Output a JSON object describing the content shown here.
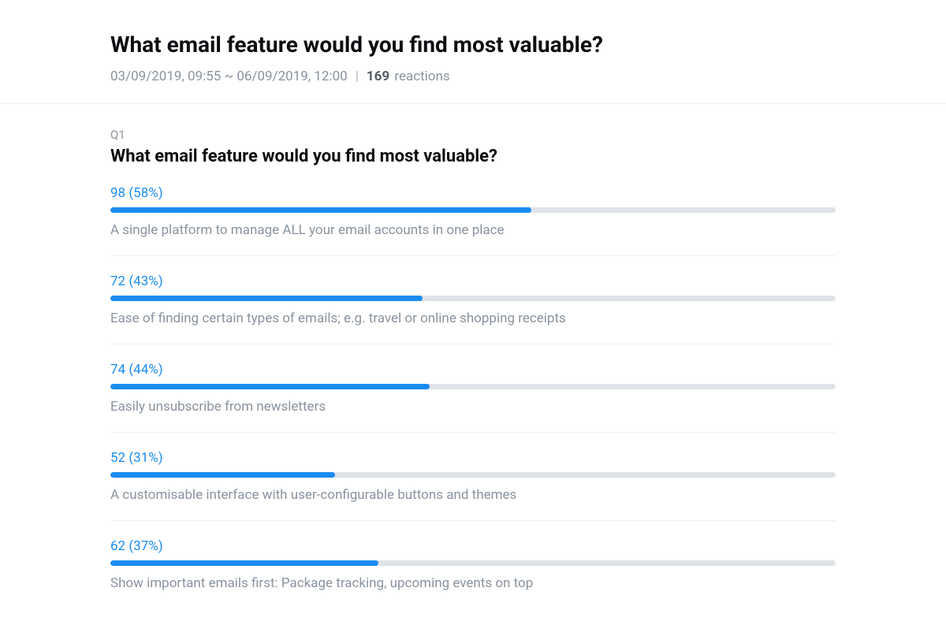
{
  "header": {
    "title": "What email feature would you find most valuable?",
    "date_range": "03/09/2019, 09:55 ~ 06/09/2019, 12:00",
    "reactions_count": "169",
    "reactions_label": "reactions"
  },
  "question": {
    "label": "Q1",
    "title": "What email feature would you find most valuable?"
  },
  "results": [
    {
      "count": 98,
      "percent": 58,
      "stat_text": "98 (58%)",
      "label": "A single platform to manage ALL your email accounts in one place"
    },
    {
      "count": 72,
      "percent": 43,
      "stat_text": "72 (43%)",
      "label": "Ease of finding certain types of emails; e.g. travel or online shopping receipts"
    },
    {
      "count": 74,
      "percent": 44,
      "stat_text": "74 (44%)",
      "label": "Easily unsubscribe from newsletters"
    },
    {
      "count": 52,
      "percent": 31,
      "stat_text": "52 (31%)",
      "label": "A customisable interface with user-configurable buttons and themes"
    },
    {
      "count": 62,
      "percent": 37,
      "stat_text": "62 (37%)",
      "label": "Show important emails first: Package tracking, upcoming events on top"
    }
  ],
  "chart_data": {
    "type": "bar",
    "orientation": "horizontal",
    "title": "What email feature would you find most valuable?",
    "xlabel": "",
    "ylabel": "",
    "xlim": [
      0,
      100
    ],
    "categories": [
      "A single platform to manage ALL your email accounts in one place",
      "Ease of finding certain types of emails; e.g. travel or online shopping receipts",
      "Easily unsubscribe from newsletters",
      "A customisable interface with user-configurable buttons and themes",
      "Show important emails first: Package tracking, upcoming events on top"
    ],
    "series": [
      {
        "name": "Percent",
        "values": [
          58,
          43,
          44,
          31,
          37
        ]
      },
      {
        "name": "Count",
        "values": [
          98,
          72,
          74,
          52,
          62
        ]
      }
    ]
  }
}
